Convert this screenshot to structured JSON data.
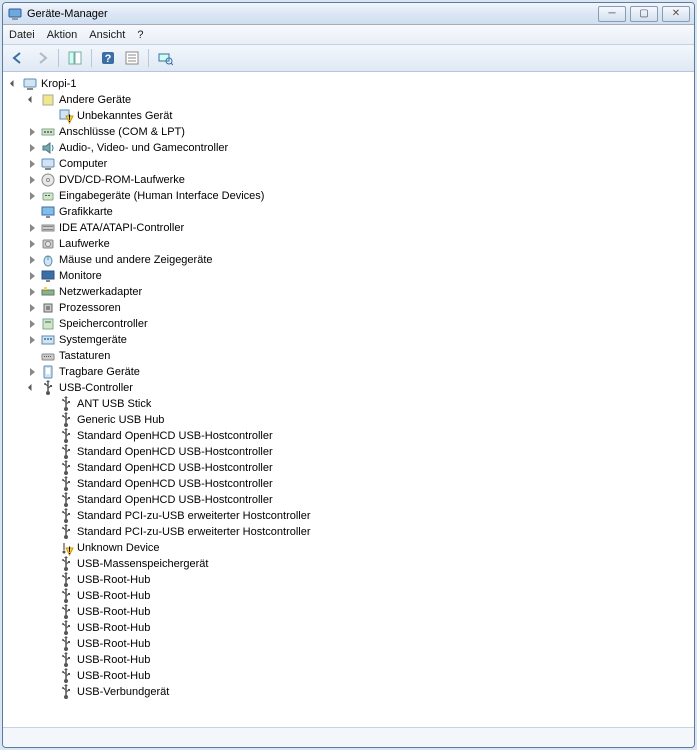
{
  "window": {
    "title": "Geräte-Manager"
  },
  "menu": [
    "Datei",
    "Aktion",
    "Ansicht",
    "?"
  ],
  "tree": [
    {
      "d": 0,
      "exp": "open",
      "i": "pc",
      "t": "Kropi-1"
    },
    {
      "d": 1,
      "exp": "open",
      "i": "other",
      "t": "Andere Geräte"
    },
    {
      "d": 2,
      "exp": "none",
      "i": "warn",
      "t": "Unbekanntes Gerät"
    },
    {
      "d": 1,
      "exp": "closed",
      "i": "port",
      "t": "Anschlüsse (COM & LPT)"
    },
    {
      "d": 1,
      "exp": "closed",
      "i": "audio",
      "t": "Audio-, Video- und Gamecontroller"
    },
    {
      "d": 1,
      "exp": "closed",
      "i": "pc",
      "t": "Computer"
    },
    {
      "d": 1,
      "exp": "closed",
      "i": "dvd",
      "t": "DVD/CD-ROM-Laufwerke"
    },
    {
      "d": 1,
      "exp": "closed",
      "i": "hid",
      "t": "Eingabegeräte (Human Interface Devices)"
    },
    {
      "d": 1,
      "exp": "none",
      "i": "gfx",
      "t": "Grafikkarte"
    },
    {
      "d": 1,
      "exp": "closed",
      "i": "ide",
      "t": "IDE ATA/ATAPI-Controller"
    },
    {
      "d": 1,
      "exp": "closed",
      "i": "disk",
      "t": "Laufwerke"
    },
    {
      "d": 1,
      "exp": "closed",
      "i": "mouse",
      "t": "Mäuse und andere Zeigegeräte"
    },
    {
      "d": 1,
      "exp": "closed",
      "i": "mon",
      "t": "Monitore"
    },
    {
      "d": 1,
      "exp": "closed",
      "i": "net",
      "t": "Netzwerkadapter"
    },
    {
      "d": 1,
      "exp": "closed",
      "i": "cpu",
      "t": "Prozessoren"
    },
    {
      "d": 1,
      "exp": "closed",
      "i": "stor",
      "t": "Speichercontroller"
    },
    {
      "d": 1,
      "exp": "closed",
      "i": "sys",
      "t": "Systemgeräte"
    },
    {
      "d": 1,
      "exp": "none",
      "i": "kbd",
      "t": "Tastaturen"
    },
    {
      "d": 1,
      "exp": "closed",
      "i": "port2",
      "t": "Tragbare Geräte"
    },
    {
      "d": 1,
      "exp": "open",
      "i": "usb",
      "t": "USB-Controller"
    },
    {
      "d": 2,
      "exp": "none",
      "i": "usb",
      "t": "ANT USB Stick"
    },
    {
      "d": 2,
      "exp": "none",
      "i": "usb",
      "t": "Generic USB Hub"
    },
    {
      "d": 2,
      "exp": "none",
      "i": "usb",
      "t": "Standard OpenHCD USB-Hostcontroller"
    },
    {
      "d": 2,
      "exp": "none",
      "i": "usb",
      "t": "Standard OpenHCD USB-Hostcontroller"
    },
    {
      "d": 2,
      "exp": "none",
      "i": "usb",
      "t": "Standard OpenHCD USB-Hostcontroller"
    },
    {
      "d": 2,
      "exp": "none",
      "i": "usb",
      "t": "Standard OpenHCD USB-Hostcontroller"
    },
    {
      "d": 2,
      "exp": "none",
      "i": "usb",
      "t": "Standard OpenHCD USB-Hostcontroller"
    },
    {
      "d": 2,
      "exp": "none",
      "i": "usb",
      "t": "Standard PCI-zu-USB erweiterter Hostcontroller"
    },
    {
      "d": 2,
      "exp": "none",
      "i": "usb",
      "t": "Standard PCI-zu-USB erweiterter Hostcontroller"
    },
    {
      "d": 2,
      "exp": "none",
      "i": "usbwarn",
      "t": "Unknown Device"
    },
    {
      "d": 2,
      "exp": "none",
      "i": "usb",
      "t": "USB-Massenspeichergerät"
    },
    {
      "d": 2,
      "exp": "none",
      "i": "usb",
      "t": "USB-Root-Hub"
    },
    {
      "d": 2,
      "exp": "none",
      "i": "usb",
      "t": "USB-Root-Hub"
    },
    {
      "d": 2,
      "exp": "none",
      "i": "usb",
      "t": "USB-Root-Hub"
    },
    {
      "d": 2,
      "exp": "none",
      "i": "usb",
      "t": "USB-Root-Hub"
    },
    {
      "d": 2,
      "exp": "none",
      "i": "usb",
      "t": "USB-Root-Hub"
    },
    {
      "d": 2,
      "exp": "none",
      "i": "usb",
      "t": "USB-Root-Hub"
    },
    {
      "d": 2,
      "exp": "none",
      "i": "usb",
      "t": "USB-Root-Hub"
    },
    {
      "d": 2,
      "exp": "none",
      "i": "usb",
      "t": "USB-Verbundgerät"
    }
  ]
}
